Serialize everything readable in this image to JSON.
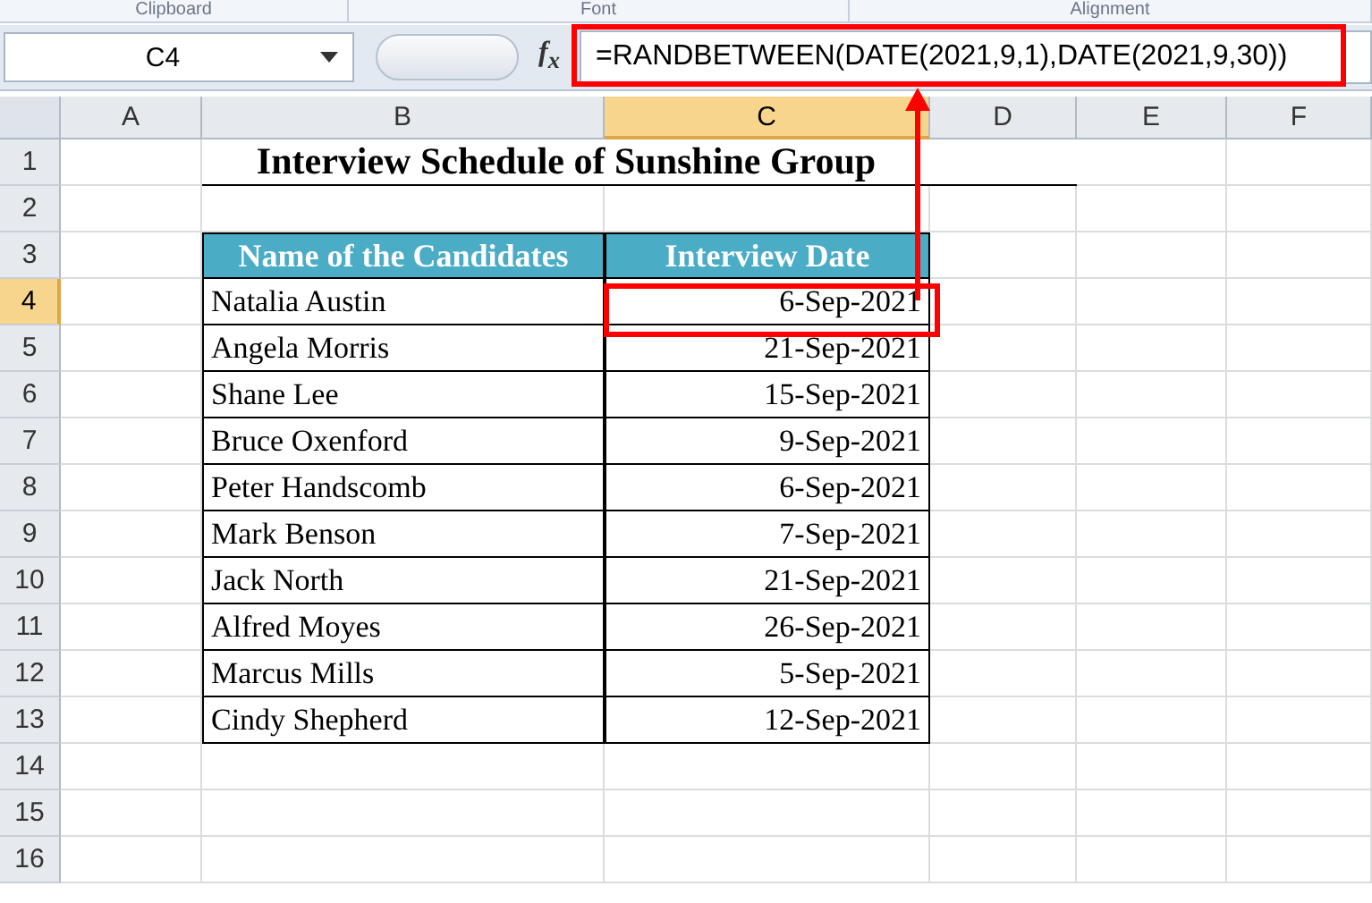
{
  "ribbon_groups": [
    "Clipboard",
    "Font",
    "Alignment"
  ],
  "name_box": "C4",
  "function_label": "f$_{x}$",
  "formula": "=RANDBETWEEN(DATE(2021,9,1),DATE(2021,9,30))",
  "columns": [
    {
      "label": "A",
      "selected": false
    },
    {
      "label": "B",
      "selected": false
    },
    {
      "label": "C",
      "selected": true
    },
    {
      "label": "D",
      "selected": false
    },
    {
      "label": "E",
      "selected": false
    },
    {
      "label": "F",
      "selected": false
    }
  ],
  "row_numbers": [
    {
      "label": "1",
      "selected": false
    },
    {
      "label": "2",
      "selected": false
    },
    {
      "label": "3",
      "selected": false
    },
    {
      "label": "4",
      "selected": true
    },
    {
      "label": "5",
      "selected": false
    },
    {
      "label": "6",
      "selected": false
    },
    {
      "label": "7",
      "selected": false
    },
    {
      "label": "8",
      "selected": false
    },
    {
      "label": "9",
      "selected": false
    },
    {
      "label": "10",
      "selected": false
    },
    {
      "label": "11",
      "selected": false
    },
    {
      "label": "12",
      "selected": false
    },
    {
      "label": "13",
      "selected": false
    },
    {
      "label": "14",
      "selected": false
    },
    {
      "label": "15",
      "selected": false
    },
    {
      "label": "16",
      "selected": false
    }
  ],
  "title": "Interview Schedule of Sunshine Group",
  "table": {
    "columns": [
      "Name of the Candidates",
      "Interview Date"
    ],
    "rows": [
      {
        "name": "Natalia Austin",
        "date": "6-Sep-2021"
      },
      {
        "name": "Angela Morris",
        "date": "21-Sep-2021"
      },
      {
        "name": "Shane Lee",
        "date": "15-Sep-2021"
      },
      {
        "name": "Bruce Oxenford",
        "date": "9-Sep-2021"
      },
      {
        "name": "Peter Handscomb",
        "date": "6-Sep-2021"
      },
      {
        "name": "Mark Benson",
        "date": "7-Sep-2021"
      },
      {
        "name": "Jack North",
        "date": "21-Sep-2021"
      },
      {
        "name": "Alfred Moyes",
        "date": "26-Sep-2021"
      },
      {
        "name": "Marcus Mills",
        "date": "5-Sep-2021"
      },
      {
        "name": "Cindy Shepherd",
        "date": "12-Sep-2021"
      }
    ]
  }
}
